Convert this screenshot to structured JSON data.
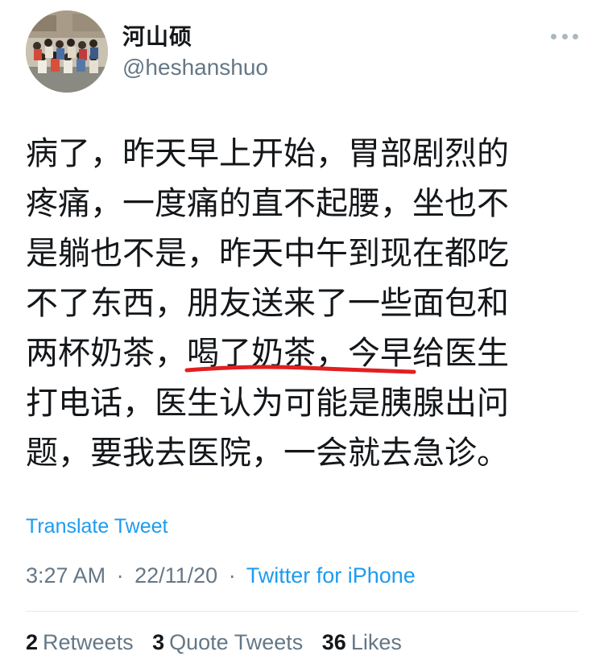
{
  "author": {
    "display_name": "河山硕",
    "handle": "@heshanshuo"
  },
  "tweet": {
    "lines": [
      "病了，昨天早上开始，胃部剧烈的",
      "疼痛，一度痛的直不起腰，坐也不",
      "是躺也不是，昨天中午到现在都吃",
      "不了东西，朋友送来了一些面包和",
      "两杯奶茶，喝了奶茶，今早给医生",
      "打电话，医生认为可能是胰腺出问",
      "题，要我去医院，一会就去急诊。"
    ],
    "highlight_color": "#e02020"
  },
  "translate_label": "Translate Tweet",
  "meta": {
    "time": "3:27 AM",
    "separator": "·",
    "date": "22/11/20",
    "source": "Twitter for iPhone"
  },
  "stats": {
    "retweets_count": "2",
    "retweets_label": "Retweets",
    "quotes_count": "3",
    "quotes_label": "Quote Tweets",
    "likes_count": "36",
    "likes_label": "Likes"
  },
  "colors": {
    "link": "#1d9bf0",
    "secondary": "#657786",
    "text": "#14171a"
  },
  "icons": {
    "more": "more-options-icon"
  }
}
